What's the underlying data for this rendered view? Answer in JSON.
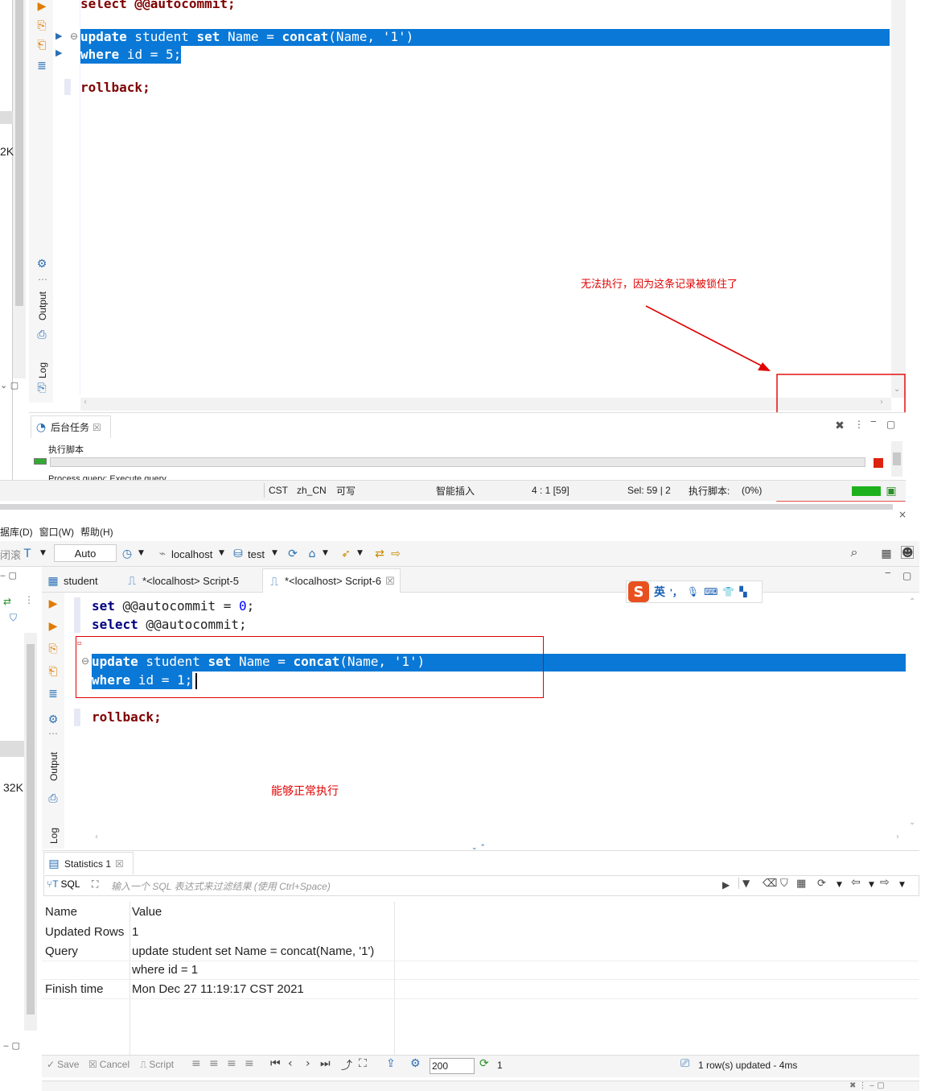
{
  "top": {
    "code": {
      "l1": "select @@autocommit;",
      "l2a": "update",
      "l2b": " student ",
      "l2c": "set",
      "l2d": " Name = ",
      "l2e": "concat",
      "l2f": "(Name, '1')",
      "l3a": "where",
      "l3b": " id = 5;",
      "l4": "rollback;"
    },
    "annotation": "无法执行，因为这条记录被锁住了",
    "left_size": "2K",
    "side_output": "Output",
    "side_log": "Log",
    "bg_tab": "后台任务",
    "bg_task": "执行脚本",
    "bg_process": "Process query:  Execute query",
    "status": {
      "tz": "CST",
      "locale": "zh_CN",
      "mode": "可写",
      "insert": "智能插入",
      "pos": "4 : 1 [59]",
      "sel": "Sel: 59 | 2",
      "exec": "执行脚本:",
      "pct": "(0%)"
    }
  },
  "bottom": {
    "menu": {
      "db": "据库(D)",
      "win": "窗口(W)",
      "help": "帮助(H)"
    },
    "toolbar": {
      "left": "闭滚",
      "auto": "Auto",
      "host": "localhost",
      "db": "test"
    },
    "tabs": {
      "t1": "student",
      "t2": "*<localhost> Script-5",
      "t3": "*<localhost> Script-6"
    },
    "ime": {
      "en": "英",
      "punct": "'，"
    },
    "code": {
      "l1a": "set",
      "l1b": " @@autocommit = ",
      "l1c": "0",
      "l1d": ";",
      "l2a": "select",
      "l2b": " @@autocommit;",
      "l3a": "update",
      "l3b": " student ",
      "l3c": "set",
      "l3d": " Name = ",
      "l3e": "concat",
      "l3f": "(Name, '1')",
      "l4a": "where",
      "l4b": " id = 1;",
      "l5": "rollback;"
    },
    "annotation": "能够正常执行",
    "left_size": "32K",
    "side_output": "Output",
    "side_log": "Log",
    "stats_tab": "Statistics 1",
    "filter_label": "SQL",
    "filter_placeholder": "输入一个 SQL 表达式来过滤结果 (使用 Ctrl+Space)",
    "table": {
      "h_name": "Name",
      "h_value": "Value",
      "r1n": "Updated Rows",
      "r1v": "1",
      "r2n": "Query",
      "r2v": "update student set Name = concat(Name, '1')",
      "r2v2": "where id = 1",
      "r3n": "Finish time",
      "r3v": "Mon Dec 27 11:19:17 CST 2021"
    },
    "footer": {
      "save": "Save",
      "cancel": "Cancel",
      "script": "Script",
      "limit": "200",
      "count": "1",
      "status": "1 row(s) updated - 4ms"
    }
  },
  "colors": {
    "selection": "#0a78d6",
    "annotation": "#e00000",
    "keyword": "#000080"
  }
}
